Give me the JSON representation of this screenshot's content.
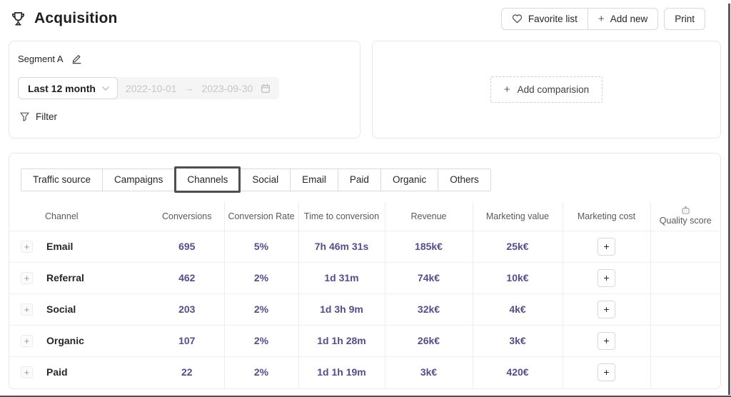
{
  "header": {
    "title": "Acquisition",
    "favorite_label": "Favorite list",
    "add_new_label": "Add new",
    "print_label": "Print"
  },
  "segment": {
    "name": "Segment A",
    "period": "Last 12 month",
    "date_start": "2022-10-01",
    "date_separator": "→",
    "date_end": "2023-09-30",
    "filter_label": "Filter"
  },
  "comparison": {
    "add_label": "Add comparision"
  },
  "icons": {
    "plus": "+"
  },
  "tabs": [
    {
      "label": "Traffic source",
      "active": false
    },
    {
      "label": "Campaigns",
      "active": false
    },
    {
      "label": "Channels",
      "active": true
    },
    {
      "label": "Social",
      "active": false
    },
    {
      "label": "Email",
      "active": false
    },
    {
      "label": "Paid",
      "active": false
    },
    {
      "label": "Organic",
      "active": false
    },
    {
      "label": "Others",
      "active": false
    }
  ],
  "table": {
    "columns": [
      "Channel",
      "Conversions",
      "Conversion Rate",
      "Time to conversion",
      "Revenue",
      "Marketing value",
      "Marketing cost",
      "Quality score"
    ],
    "rows": [
      {
        "channel": "Email",
        "conversions": "695",
        "conversion_rate": "5%",
        "time_to_conversion": "7h 46m 31s",
        "revenue": "185k€",
        "marketing_value": "25k€",
        "quality_score": ""
      },
      {
        "channel": "Referral",
        "conversions": "462",
        "conversion_rate": "2%",
        "time_to_conversion": "1d 31m",
        "revenue": "74k€",
        "marketing_value": "10k€",
        "quality_score": ""
      },
      {
        "channel": "Social",
        "conversions": "203",
        "conversion_rate": "2%",
        "time_to_conversion": "1d 3h 9m",
        "revenue": "32k€",
        "marketing_value": "4k€",
        "quality_score": ""
      },
      {
        "channel": "Organic",
        "conversions": "107",
        "conversion_rate": "2%",
        "time_to_conversion": "1d 1h 28m",
        "revenue": "26k€",
        "marketing_value": "3k€",
        "quality_score": ""
      },
      {
        "channel": "Paid",
        "conversions": "22",
        "conversion_rate": "2%",
        "time_to_conversion": "1d 1h 19m",
        "revenue": "3k€",
        "marketing_value": "420€",
        "quality_score": ""
      }
    ]
  },
  "colors": {
    "accent_purple": "#524e8c",
    "text_dark": "#262626",
    "text_muted": "#595959",
    "control_border": "#d9d9d9",
    "panel_border": "#e8e8e8",
    "active_tab_border": "#4f4f4f",
    "disabled_bg": "#f5f5f5"
  }
}
